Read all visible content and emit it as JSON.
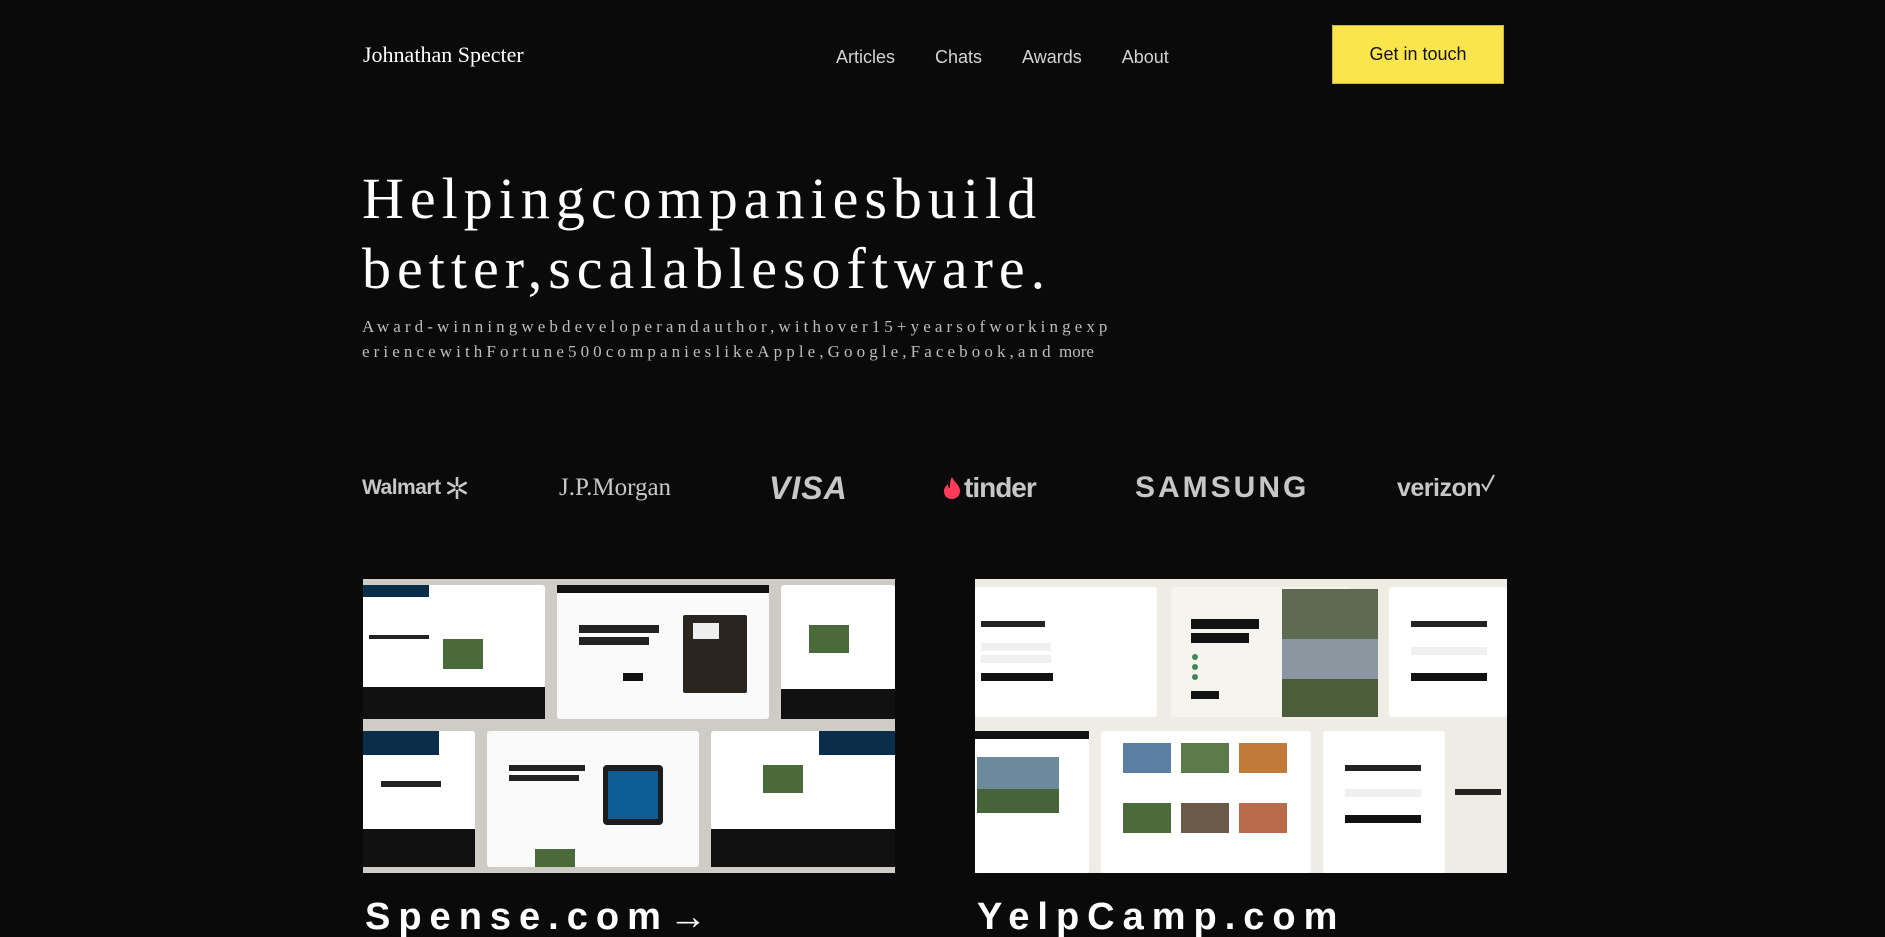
{
  "header": {
    "brand": "Johnathan Specter",
    "nav": [
      "Articles",
      "Chats",
      "Awards",
      "About"
    ],
    "cta_label": "Get in touch",
    "cta_color": "#fbe54d"
  },
  "hero": {
    "title_line1": "Helpingcompaniesbuild",
    "title_line2": "better,scalablesoftware.",
    "subtitle_spaced": "Award-winningwebdeveloperandauthor,withover15+yearsofworkingexperiencewithFortune500companieslikeApple,Google,Facebook,and",
    "subtitle_tail": " more"
  },
  "logos": {
    "walmart": "Walmart",
    "jpmorgan": "J.P.Morgan",
    "visa": "VISA",
    "tinder": "tinder",
    "samsung": "SAMSUNG",
    "verizon": "verizon"
  },
  "projects": [
    {
      "title": "Spense.com→",
      "icon": "arrow-right"
    },
    {
      "title": "YelpCamp.com"
    }
  ],
  "colors": {
    "background": "#0b0a0b",
    "accent": "#fbe54d",
    "tinder": "#fe3c5a",
    "verizon_check": "#e8202a",
    "walmart_spark": "#c7c7c7"
  }
}
